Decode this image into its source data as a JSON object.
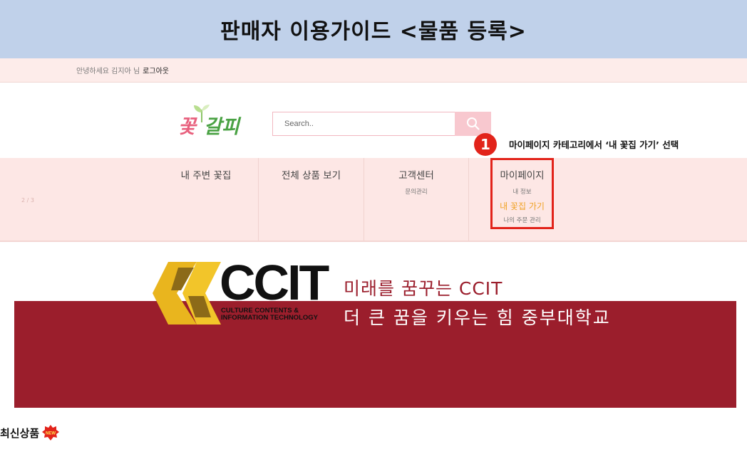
{
  "guide": {
    "title": "판매자 이용가이드 <물품 등록>"
  },
  "topbar": {
    "greeting": "안녕하세요 김지아 님",
    "logout_label": "로그아웃"
  },
  "logo": {
    "text_part1": "꽃",
    "text_part2": "갈피"
  },
  "search": {
    "placeholder": "Search.."
  },
  "annotation": {
    "number": "1",
    "text": "마이페이지 카테고리에서 ‘내 꽃집 가기’ 선택"
  },
  "nav": {
    "items": [
      {
        "label": "내 주변 꽃집"
      },
      {
        "label": "전체 상품 보기"
      },
      {
        "label": "고객센터",
        "sub": [
          "문의관리"
        ]
      },
      {
        "label": "마이페이지",
        "sub": [
          "내 정보",
          "내 꽃집 가기",
          "나의 주문 관리"
        ]
      }
    ],
    "ghost_text": "2 / 3"
  },
  "banner": {
    "brand": "CCIT",
    "brand_sub1": "CULTURE CONTENTS &",
    "brand_sub2": "INFORMATION TECHNOLOGY",
    "slogan1": "미래를 꿈꾸는 CCIT",
    "slogan2": "더 큰 꿈을 키우는 힘 중부대학교"
  },
  "section": {
    "new_title": "최신상품",
    "badge_text": "NEW"
  },
  "colors": {
    "guide_header_bg": "#c0d1ea",
    "topbar_bg": "#fdecea",
    "nav_bg": "#fde7e5",
    "highlight": "#f0a224",
    "annotation_red": "#e2231a",
    "banner_bg": "#9b1e2c",
    "ccit_gold": "#e9b51e"
  },
  "icons": {
    "search": "search-icon",
    "sprout": "sprout-icon",
    "new_badge": "new-badge-icon"
  }
}
